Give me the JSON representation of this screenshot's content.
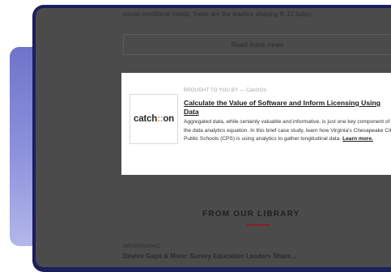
{
  "news": {
    "top_text": "social-emotional needs, these are the leaders shaping K-12 today.",
    "read_more_label": "Read more news"
  },
  "sponsored": {
    "brought_by": "BROUGHT TO YOU BY — CatchOn",
    "logo_prefix": "catch",
    "logo_mark": "::",
    "logo_suffix": "on",
    "title": "Calculate the Value of Software and Inform Licensing Using Data",
    "body": "Aggregated data, while certainly valuable and informative, is just one key component of the data analytics equation. In this brief case study, learn how Virginia's Chesapeake City Public Schools (CPS) is using analytics to gather longitudinal data.",
    "learn_more": "Learn more."
  },
  "library": {
    "heading": "FROM OUR LIBRARY",
    "category": "INFOGRAPHIC",
    "cut_title": "Device Gaps & More: Survey Education Leaders Share..."
  },
  "colors": {
    "overlay": "#4b4b4b",
    "frame": "#1b1f5e",
    "accent_underline": "#8a1e2b",
    "logo_accent": "#e58b2b"
  }
}
